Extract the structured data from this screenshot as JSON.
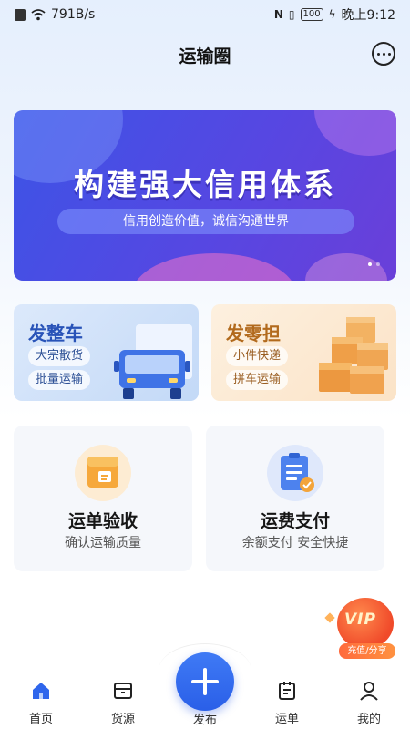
{
  "status_bar": {
    "network_speed": "791B/s",
    "battery": "100",
    "time": "晚上9:12"
  },
  "header": {
    "title": "运输圈",
    "chat_icon": "chat-bubble-icon"
  },
  "banner": {
    "title": "构建强大信用体系",
    "subtitle": "信用创造价值，诚信沟通世界"
  },
  "shipping": {
    "full_load": {
      "title": "发整车",
      "tags": [
        "大宗散货",
        "批量运输"
      ],
      "icon": "truck-icon"
    },
    "less_than_load": {
      "title": "发零担",
      "tags": [
        "小件快递",
        "拼车运输"
      ],
      "icon": "boxes-icon"
    }
  },
  "services": [
    {
      "title": "运单验收",
      "subtitle": "确认运输质量",
      "icon": "package-icon"
    },
    {
      "title": "运费支付",
      "subtitle": "余额支付 安全快捷",
      "icon": "clipboard-check-icon"
    }
  ],
  "vip": {
    "text": "VIP",
    "label": "充值/分享"
  },
  "tabs": [
    {
      "label": "首页",
      "icon": "home-icon",
      "active": true
    },
    {
      "label": "货源",
      "icon": "box-icon",
      "active": false
    },
    {
      "label": "发布",
      "icon": "plus-icon",
      "active": false
    },
    {
      "label": "运单",
      "icon": "waybill-icon",
      "active": false
    },
    {
      "label": "我的",
      "icon": "user-icon",
      "active": false
    }
  ],
  "colors": {
    "primary": "#2f66ec",
    "banner": "#4a4fe3",
    "full_load_title": "#2853b8",
    "less_load_title": "#b26a1d"
  }
}
